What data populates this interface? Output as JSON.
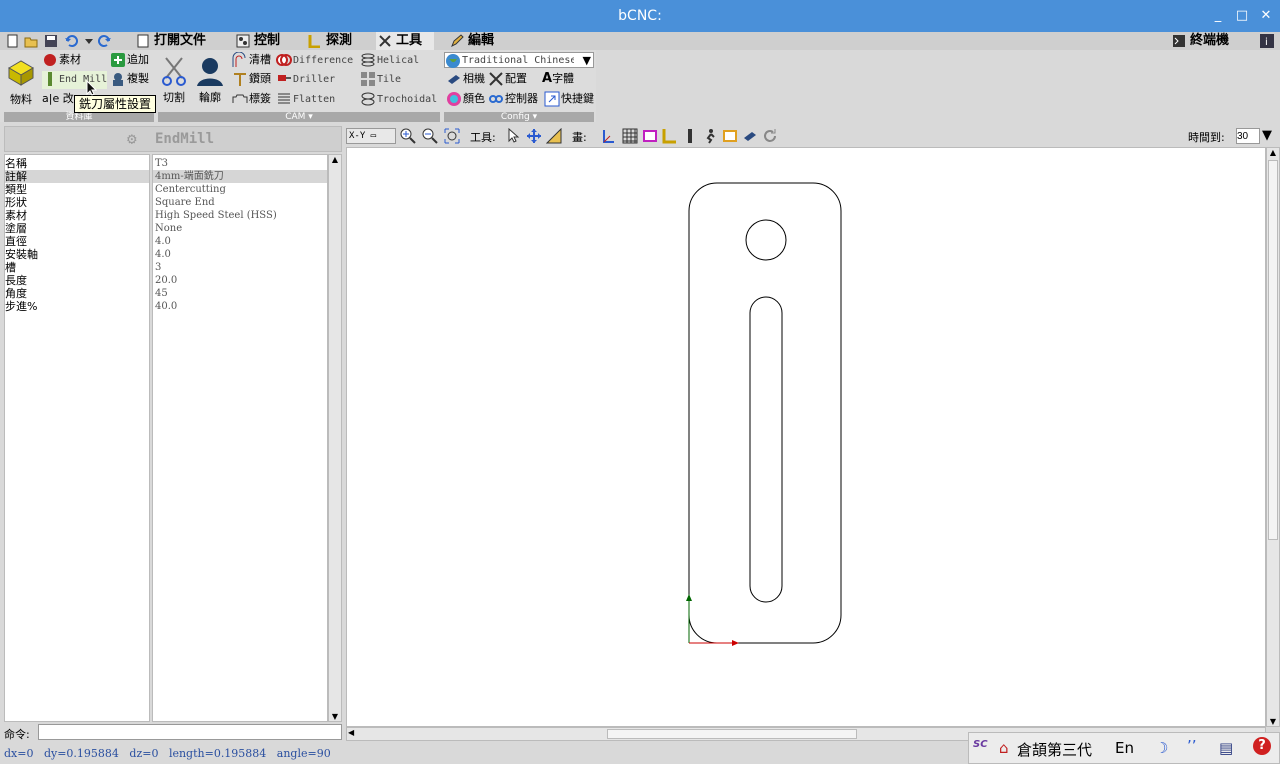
{
  "window": {
    "title": "bCNC:"
  },
  "menu": {
    "tabs": [
      {
        "label": "打開文件"
      },
      {
        "label": "控制"
      },
      {
        "label": "探測"
      },
      {
        "label": "工具"
      },
      {
        "label": "編輯"
      }
    ],
    "terminal_label": "終端機"
  },
  "ribbon": {
    "database": {
      "stock_big_label": "物料",
      "stock_label": "素材",
      "endmill_label": "End Mill",
      "rename_label": "改",
      "add_label": "追加",
      "copy_label": "複製",
      "group_label": "資料庫"
    },
    "cam": {
      "cut_label": "切割",
      "profile_label": "輪廓",
      "pocket_label": "清槽",
      "drill_label": "鑽頭",
      "tabs_label": "標簽",
      "difference_label": "Difference",
      "driller_label": "Driller",
      "flatten_label": "Flatten",
      "helical_label": "Helical",
      "tile_label": "Tile",
      "trochoidal_label": "Trochoidal",
      "group_label": "CAM"
    },
    "config": {
      "language_value": "Traditional Chinese",
      "camera_label": "相機",
      "settings_label": "配置",
      "font_label": "字體",
      "color_label": "顏色",
      "controller_label": "控制器",
      "shortcut_label": "快捷鍵",
      "group_label": "Config"
    }
  },
  "tooltip": {
    "text": "銑刀屬性設置"
  },
  "editor": {
    "header": "EndMill",
    "properties": [
      {
        "name": "名稱",
        "value": "T3"
      },
      {
        "name": "註解",
        "value": "4mm-端面銑刀"
      },
      {
        "name": "類型",
        "value": "Centercutting"
      },
      {
        "name": "形狀",
        "value": "Square End"
      },
      {
        "name": "素材",
        "value": "High Speed Steel (HSS)"
      },
      {
        "name": "塗層",
        "value": "None"
      },
      {
        "name": "直徑",
        "value": "4.0"
      },
      {
        "name": "安裝軸",
        "value": "4.0"
      },
      {
        "name": "槽",
        "value": "3"
      },
      {
        "name": "長度",
        "value": "20.0"
      },
      {
        "name": "角度",
        "value": "45"
      },
      {
        "name": "步進%",
        "value": "40.0"
      }
    ],
    "selected_index": 1
  },
  "command": {
    "label": "命令:",
    "value": ""
  },
  "status": {
    "text": "dx=0   dy=0.195884   dz=0   length=0.195884   angle=90"
  },
  "viewbar": {
    "view_value": "X-Y",
    "tools_label": "工具:",
    "draw_label": "畫:",
    "timeout_label": "時間到:",
    "timeout_value": "30"
  },
  "ime": {
    "name": "倉頡第三代",
    "lang": "En"
  },
  "colors": {
    "titlebar": "#4a90d9",
    "axis_x": "#cc0000",
    "axis_y": "#006600"
  }
}
